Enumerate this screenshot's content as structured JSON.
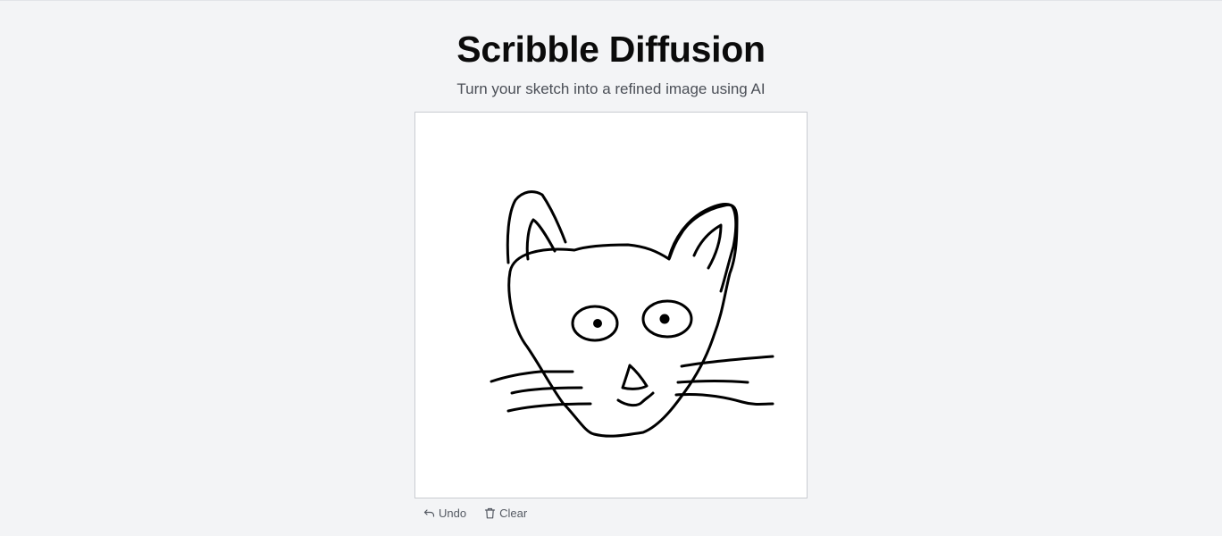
{
  "header": {
    "title": "Scribble Diffusion",
    "subtitle": "Turn your sketch into a refined image using AI"
  },
  "canvas": {
    "background": "#ffffff",
    "stroke_color": "#000000"
  },
  "toolbar": {
    "undo_label": "Undo",
    "undo_icon": "undo-icon",
    "clear_label": "Clear",
    "clear_icon": "trash-icon"
  }
}
